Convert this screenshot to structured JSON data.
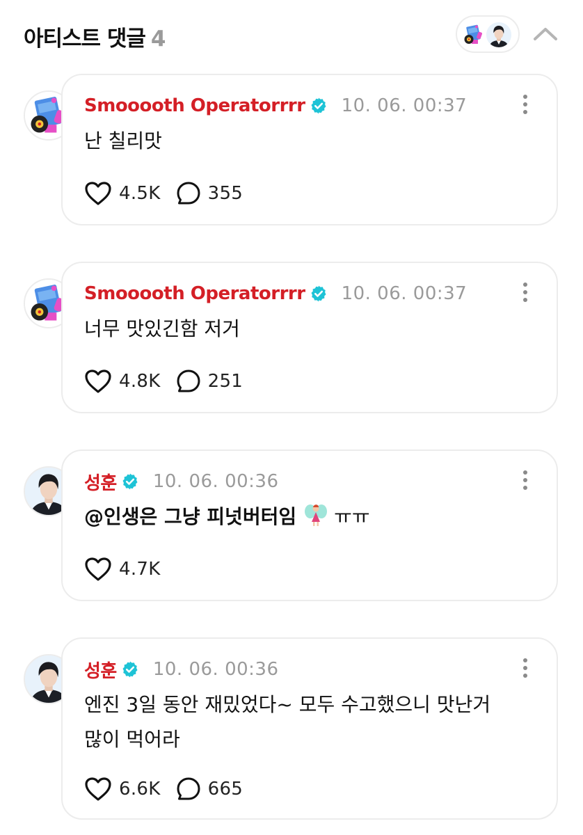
{
  "header": {
    "title": "아티스트 댓글",
    "count": "4"
  },
  "icons": {
    "collapse": "chevron-up-icon",
    "verified": "verified-badge-icon",
    "like": "heart-icon",
    "reply": "speech-bubble-icon",
    "more": "more-vertical-icon"
  },
  "colors": {
    "username": "#d41f26",
    "verified": "#1ec3d6",
    "muted": "#9a9a9a",
    "border": "#ececec"
  },
  "comments": [
    {
      "username": "Smooooth Operatorrrr",
      "timestamp": "10. 06. 00:37",
      "text": "난 칠리맛",
      "likes": "4.5K",
      "replies": "355"
    },
    {
      "username": "Smooooth Operatorrrr",
      "timestamp": "10. 06. 00:37",
      "text": "너무 맛있긴함 저거",
      "likes": "4.8K",
      "replies": "251"
    },
    {
      "username": "성훈",
      "timestamp": "10. 06. 00:36",
      "text": "@인생은 그냥 피넛버터임",
      "suffix": "ㅠㅠ",
      "likes": "4.7K"
    },
    {
      "username": "성훈",
      "timestamp": "10. 06. 00:36",
      "line1": "엔진 3일 동안 재밌었다~ 모두 수고했으니 맛난거",
      "line2": "많이 먹어라",
      "likes": "6.6K",
      "replies": "665"
    }
  ]
}
